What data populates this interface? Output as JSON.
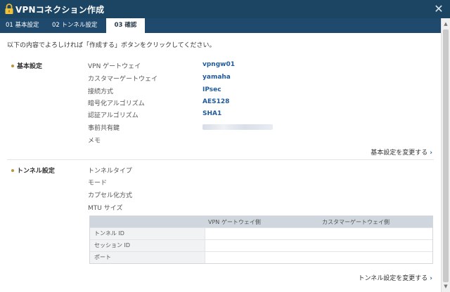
{
  "window": {
    "title": "VPNコネクション作成"
  },
  "tabs": [
    {
      "label": "01 基本設定"
    },
    {
      "label": "02 トンネル設定"
    },
    {
      "label": "03 確認"
    }
  ],
  "instruction": "以下の内容でよろしければ「作成する」ボタンをクリックしてください。",
  "basic": {
    "section_label": "基本設定",
    "rows": [
      {
        "label": "VPN ゲートウェイ",
        "value": "vpngw01"
      },
      {
        "label": "カスタマーゲートウェイ",
        "value": "yamaha"
      },
      {
        "label": "接続方式",
        "value": "IPsec"
      },
      {
        "label": "暗号化アルゴリズム",
        "value": "AES128"
      },
      {
        "label": "認証アルゴリズム",
        "value": "SHA1"
      },
      {
        "label": "事前共有鍵",
        "value": ""
      },
      {
        "label": "メモ",
        "value": ""
      }
    ],
    "change_link": "基本設定を変更する"
  },
  "tunnel": {
    "section_label": "トンネル設定",
    "rows": [
      {
        "label": "トンネルタイプ"
      },
      {
        "label": "モード"
      },
      {
        "label": "カプセル化方式"
      },
      {
        "label": "MTU サイズ"
      }
    ],
    "table": {
      "headers": [
        "VPN ゲートウェイ側",
        "カスタマーゲートウェイ側"
      ],
      "rows": [
        {
          "label": "トンネル ID"
        },
        {
          "label": "セッション ID"
        },
        {
          "label": "ポート"
        }
      ]
    },
    "change_link": "トンネル設定を変更する"
  },
  "icons": {
    "title_icon": "lock-icon",
    "close": "close-icon"
  },
  "colors": {
    "titlebar": "#1c4564",
    "tabbar": "#1f4a6e",
    "value_text": "#1e5a9c",
    "bullet": "#b8963a"
  }
}
